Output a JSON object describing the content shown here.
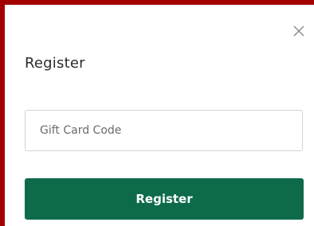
{
  "dialog": {
    "title": "Register",
    "close_icon": "close-icon",
    "gift_card_input": {
      "placeholder": "Gift Card Code",
      "value": ""
    },
    "submit_label": "Register"
  },
  "colors": {
    "frame_border": "#a30000",
    "submit_background": "#0d6b4a",
    "submit_text": "#ffffff",
    "input_border": "#cfd3d8",
    "title_text": "#2b2b2b",
    "close_icon": "#8a8a8a"
  }
}
